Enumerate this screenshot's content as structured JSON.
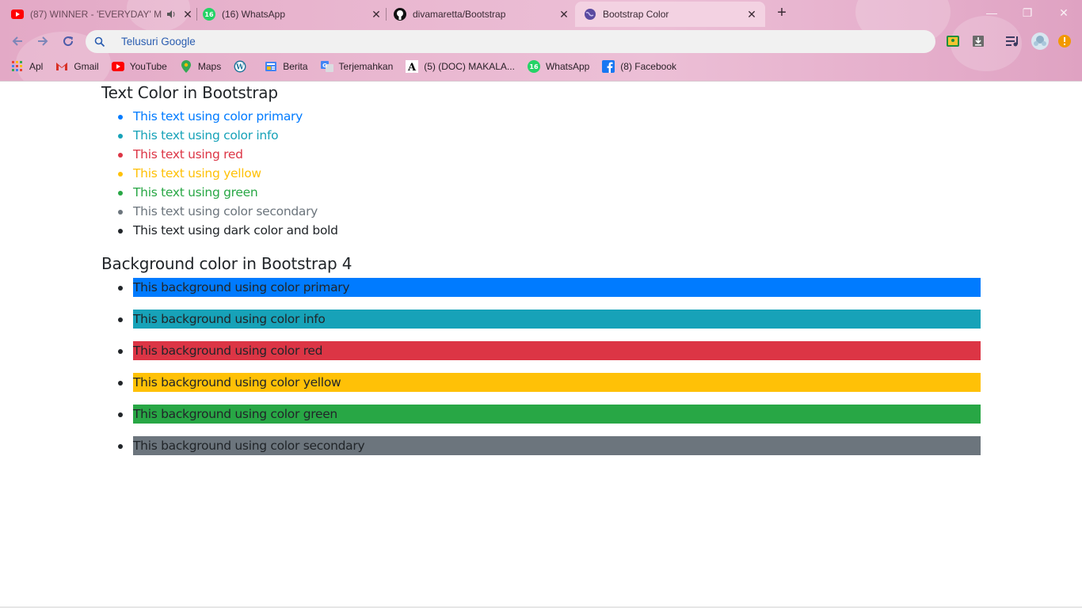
{
  "browser": {
    "tabs": [
      {
        "title": "(87) WINNER - 'EVERYDAY' M",
        "icon": "youtube-icon",
        "muted_icon": "speaker-icon",
        "active": false
      },
      {
        "title": "(16) WhatsApp",
        "icon": "whatsapp-icon",
        "active": false
      },
      {
        "title": "divamaretta/Bootstrap",
        "icon": "github-icon",
        "active": false
      },
      {
        "title": "Bootstrap Color",
        "icon": "globe-icon",
        "active": true
      }
    ],
    "new_tab_label": "+",
    "omnibox": {
      "value": "Telusuri Google",
      "placeholder": "Telusuri Google"
    },
    "bookmarks": [
      {
        "label": "Apl",
        "icon": "apps-grid-icon"
      },
      {
        "label": "Gmail",
        "icon": "gmail-icon"
      },
      {
        "label": "YouTube",
        "icon": "youtube-icon"
      },
      {
        "label": "Maps",
        "icon": "maps-icon"
      },
      {
        "label": "",
        "icon": "wordpress-icon"
      },
      {
        "label": "Berita",
        "icon": "news-icon"
      },
      {
        "label": "Terjemahkan",
        "icon": "translate-icon"
      },
      {
        "label": "(5) (DOC) MAKALA...",
        "icon": "academia-icon"
      },
      {
        "label": "WhatsApp",
        "icon": "whatsapp-icon"
      },
      {
        "label": "(8) Facebook",
        "icon": "facebook-icon"
      }
    ],
    "badge_count": "16"
  },
  "content": {
    "text_heading": "Text Color in Bootstrap",
    "text_items": [
      {
        "label": "This text using color primary",
        "color": "#007bff"
      },
      {
        "label": "This text using color info",
        "color": "#17a2b8"
      },
      {
        "label": "This text using red",
        "color": "#dc3545"
      },
      {
        "label": "This text using yellow",
        "color": "#ffc107"
      },
      {
        "label": "This text using green",
        "color": "#28a745"
      },
      {
        "label": "This text using color secondary",
        "color": "#6c757d"
      },
      {
        "label": "This text using dark color and bold",
        "color": "#212529"
      }
    ],
    "bg_heading": "Background color in Bootstrap 4",
    "bg_items": [
      {
        "label": "This background using color primary",
        "color": "#007bff"
      },
      {
        "label": "This background using color info",
        "color": "#17a2b8"
      },
      {
        "label": "This background using color red",
        "color": "#dc3545"
      },
      {
        "label": "This background using color yellow",
        "color": "#ffc107"
      },
      {
        "label": "This background using color green",
        "color": "#28a745"
      },
      {
        "label": "This background using color secondary",
        "color": "#6c757d"
      }
    ]
  }
}
